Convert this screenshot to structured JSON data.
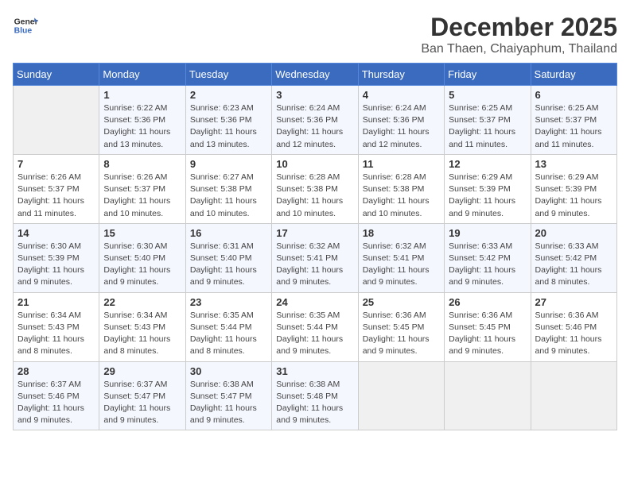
{
  "header": {
    "logo_line1": "General",
    "logo_line2": "Blue",
    "month_year": "December 2025",
    "location": "Ban Thaen, Chaiyaphum, Thailand"
  },
  "weekdays": [
    "Sunday",
    "Monday",
    "Tuesday",
    "Wednesday",
    "Thursday",
    "Friday",
    "Saturday"
  ],
  "weeks": [
    [
      {
        "day": "",
        "sunrise": "",
        "sunset": "",
        "daylight": ""
      },
      {
        "day": "1",
        "sunrise": "Sunrise: 6:22 AM",
        "sunset": "Sunset: 5:36 PM",
        "daylight": "Daylight: 11 hours and 13 minutes."
      },
      {
        "day": "2",
        "sunrise": "Sunrise: 6:23 AM",
        "sunset": "Sunset: 5:36 PM",
        "daylight": "Daylight: 11 hours and 13 minutes."
      },
      {
        "day": "3",
        "sunrise": "Sunrise: 6:24 AM",
        "sunset": "Sunset: 5:36 PM",
        "daylight": "Daylight: 11 hours and 12 minutes."
      },
      {
        "day": "4",
        "sunrise": "Sunrise: 6:24 AM",
        "sunset": "Sunset: 5:36 PM",
        "daylight": "Daylight: 11 hours and 12 minutes."
      },
      {
        "day": "5",
        "sunrise": "Sunrise: 6:25 AM",
        "sunset": "Sunset: 5:37 PM",
        "daylight": "Daylight: 11 hours and 11 minutes."
      },
      {
        "day": "6",
        "sunrise": "Sunrise: 6:25 AM",
        "sunset": "Sunset: 5:37 PM",
        "daylight": "Daylight: 11 hours and 11 minutes."
      }
    ],
    [
      {
        "day": "7",
        "sunrise": "Sunrise: 6:26 AM",
        "sunset": "Sunset: 5:37 PM",
        "daylight": "Daylight: 11 hours and 11 minutes."
      },
      {
        "day": "8",
        "sunrise": "Sunrise: 6:26 AM",
        "sunset": "Sunset: 5:37 PM",
        "daylight": "Daylight: 11 hours and 10 minutes."
      },
      {
        "day": "9",
        "sunrise": "Sunrise: 6:27 AM",
        "sunset": "Sunset: 5:38 PM",
        "daylight": "Daylight: 11 hours and 10 minutes."
      },
      {
        "day": "10",
        "sunrise": "Sunrise: 6:28 AM",
        "sunset": "Sunset: 5:38 PM",
        "daylight": "Daylight: 11 hours and 10 minutes."
      },
      {
        "day": "11",
        "sunrise": "Sunrise: 6:28 AM",
        "sunset": "Sunset: 5:38 PM",
        "daylight": "Daylight: 11 hours and 10 minutes."
      },
      {
        "day": "12",
        "sunrise": "Sunrise: 6:29 AM",
        "sunset": "Sunset: 5:39 PM",
        "daylight": "Daylight: 11 hours and 9 minutes."
      },
      {
        "day": "13",
        "sunrise": "Sunrise: 6:29 AM",
        "sunset": "Sunset: 5:39 PM",
        "daylight": "Daylight: 11 hours and 9 minutes."
      }
    ],
    [
      {
        "day": "14",
        "sunrise": "Sunrise: 6:30 AM",
        "sunset": "Sunset: 5:39 PM",
        "daylight": "Daylight: 11 hours and 9 minutes."
      },
      {
        "day": "15",
        "sunrise": "Sunrise: 6:30 AM",
        "sunset": "Sunset: 5:40 PM",
        "daylight": "Daylight: 11 hours and 9 minutes."
      },
      {
        "day": "16",
        "sunrise": "Sunrise: 6:31 AM",
        "sunset": "Sunset: 5:40 PM",
        "daylight": "Daylight: 11 hours and 9 minutes."
      },
      {
        "day": "17",
        "sunrise": "Sunrise: 6:32 AM",
        "sunset": "Sunset: 5:41 PM",
        "daylight": "Daylight: 11 hours and 9 minutes."
      },
      {
        "day": "18",
        "sunrise": "Sunrise: 6:32 AM",
        "sunset": "Sunset: 5:41 PM",
        "daylight": "Daylight: 11 hours and 9 minutes."
      },
      {
        "day": "19",
        "sunrise": "Sunrise: 6:33 AM",
        "sunset": "Sunset: 5:42 PM",
        "daylight": "Daylight: 11 hours and 9 minutes."
      },
      {
        "day": "20",
        "sunrise": "Sunrise: 6:33 AM",
        "sunset": "Sunset: 5:42 PM",
        "daylight": "Daylight: 11 hours and 8 minutes."
      }
    ],
    [
      {
        "day": "21",
        "sunrise": "Sunrise: 6:34 AM",
        "sunset": "Sunset: 5:43 PM",
        "daylight": "Daylight: 11 hours and 8 minutes."
      },
      {
        "day": "22",
        "sunrise": "Sunrise: 6:34 AM",
        "sunset": "Sunset: 5:43 PM",
        "daylight": "Daylight: 11 hours and 8 minutes."
      },
      {
        "day": "23",
        "sunrise": "Sunrise: 6:35 AM",
        "sunset": "Sunset: 5:44 PM",
        "daylight": "Daylight: 11 hours and 8 minutes."
      },
      {
        "day": "24",
        "sunrise": "Sunrise: 6:35 AM",
        "sunset": "Sunset: 5:44 PM",
        "daylight": "Daylight: 11 hours and 9 minutes."
      },
      {
        "day": "25",
        "sunrise": "Sunrise: 6:36 AM",
        "sunset": "Sunset: 5:45 PM",
        "daylight": "Daylight: 11 hours and 9 minutes."
      },
      {
        "day": "26",
        "sunrise": "Sunrise: 6:36 AM",
        "sunset": "Sunset: 5:45 PM",
        "daylight": "Daylight: 11 hours and 9 minutes."
      },
      {
        "day": "27",
        "sunrise": "Sunrise: 6:36 AM",
        "sunset": "Sunset: 5:46 PM",
        "daylight": "Daylight: 11 hours and 9 minutes."
      }
    ],
    [
      {
        "day": "28",
        "sunrise": "Sunrise: 6:37 AM",
        "sunset": "Sunset: 5:46 PM",
        "daylight": "Daylight: 11 hours and 9 minutes."
      },
      {
        "day": "29",
        "sunrise": "Sunrise: 6:37 AM",
        "sunset": "Sunset: 5:47 PM",
        "daylight": "Daylight: 11 hours and 9 minutes."
      },
      {
        "day": "30",
        "sunrise": "Sunrise: 6:38 AM",
        "sunset": "Sunset: 5:47 PM",
        "daylight": "Daylight: 11 hours and 9 minutes."
      },
      {
        "day": "31",
        "sunrise": "Sunrise: 6:38 AM",
        "sunset": "Sunset: 5:48 PM",
        "daylight": "Daylight: 11 hours and 9 minutes."
      },
      {
        "day": "",
        "sunrise": "",
        "sunset": "",
        "daylight": ""
      },
      {
        "day": "",
        "sunrise": "",
        "sunset": "",
        "daylight": ""
      },
      {
        "day": "",
        "sunrise": "",
        "sunset": "",
        "daylight": ""
      }
    ]
  ]
}
